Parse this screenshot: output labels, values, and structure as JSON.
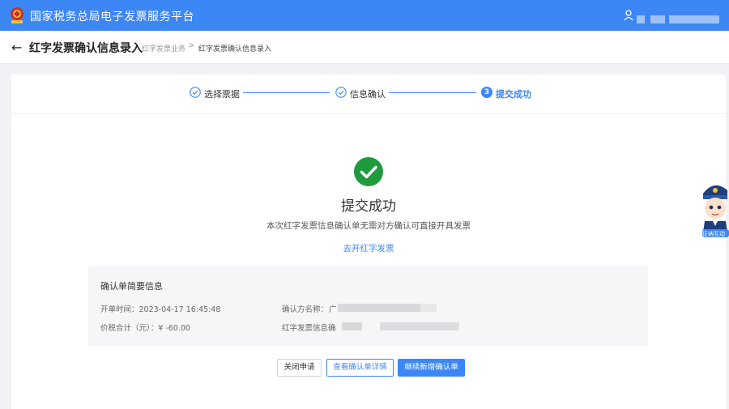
{
  "header": {
    "app_title": "国家税务总局电子发票服务平台",
    "user_name": ""
  },
  "breadcrumb": {
    "page_title": "红字发票确认信息录入",
    "items": [
      "红字发票业务",
      "红字发票确认信息录入"
    ],
    "separator": ">"
  },
  "steps": [
    {
      "label": "选择票据",
      "state": "done"
    },
    {
      "label": "信息确认",
      "state": "done"
    },
    {
      "label": "提交成功",
      "state": "active",
      "number": "3"
    }
  ],
  "result": {
    "title": "提交成功",
    "description": "本次红字发票信息确认单无需对方确认可直接开具发票",
    "link": "去开红字发票"
  },
  "summary": {
    "title": "确认单简要信息",
    "open_time": "开单时间：2023-04-17 16:45:48",
    "total": "价税合计（元）：¥ -60.00",
    "confirm_party": "确认方名称：",
    "confirm_party_prefix": "广",
    "red_invoice_info": "红字发票信息确"
  },
  "buttons": {
    "close": "关闭申请",
    "view": "查看确认单详情",
    "continue": "继续新增确认单"
  },
  "assistant": {
    "label": "征纳互动"
  },
  "colors": {
    "primary": "#3d86f5",
    "success": "#1e9b3c"
  }
}
